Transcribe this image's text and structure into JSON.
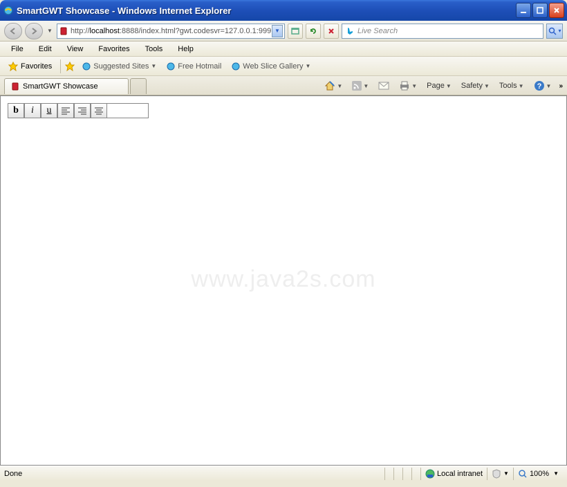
{
  "window": {
    "title": "SmartGWT Showcase - Windows Internet Explorer"
  },
  "nav": {
    "url_prefix": "http://",
    "url_host": "localhost",
    "url_rest": ":8888/index.html?gwt.codesvr=127.0.0.1:999"
  },
  "search": {
    "placeholder": "Live Search"
  },
  "menu": {
    "file": "File",
    "edit": "Edit",
    "view": "View",
    "favorites": "Favorites",
    "tools": "Tools",
    "help": "Help"
  },
  "favbar": {
    "favorites": "Favorites",
    "suggested": "Suggested Sites",
    "hotmail": "Free Hotmail",
    "webslice": "Web Slice Gallery"
  },
  "tab": {
    "title": "SmartGWT Showcase"
  },
  "cmd": {
    "page": "Page",
    "safety": "Safety",
    "tools": "Tools"
  },
  "toolbar": {
    "bold": "b",
    "italic": "i",
    "underline": "u"
  },
  "watermark": "www.java2s.com",
  "status": {
    "done": "Done",
    "zone": "Local intranet",
    "zoom": "100%"
  }
}
